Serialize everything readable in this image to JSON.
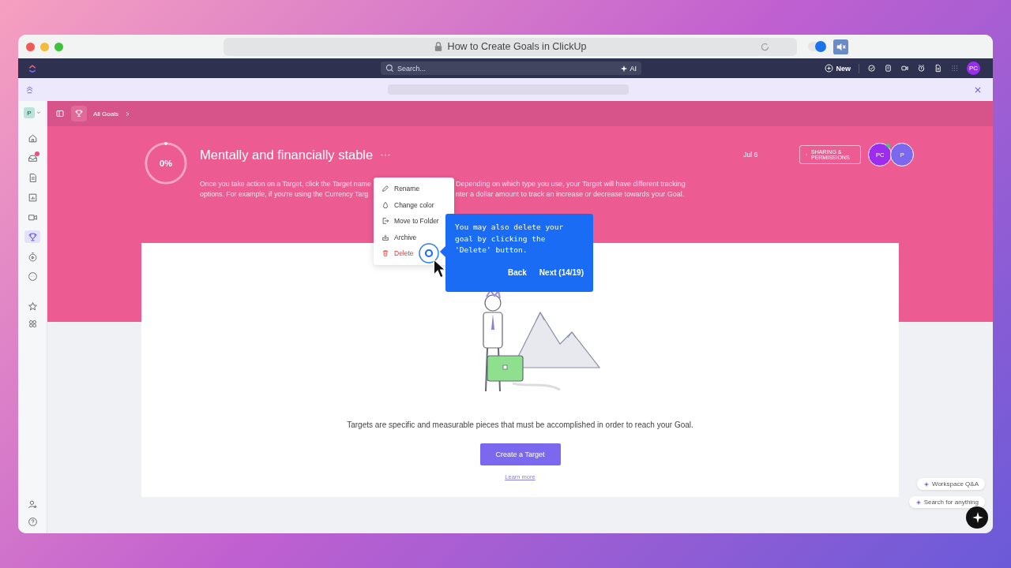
{
  "browser": {
    "title": "How to Create Goals in ClickUp",
    "autoplay_on": true
  },
  "topbar": {
    "search": {
      "placeholder": "Search..."
    },
    "ai_label": "AI",
    "new_label": "New",
    "avatar": "PC"
  },
  "workspace": {
    "initial": "P"
  },
  "sidebar": {
    "items": [
      {
        "selected": false
      },
      {
        "selected": false,
        "badge": true
      },
      {
        "selected": false
      },
      {
        "selected": false
      },
      {
        "selected": false
      },
      {
        "selected": true
      },
      {
        "selected": false
      },
      {
        "selected": false
      }
    ]
  },
  "breadcrumb": {
    "label": "All Goals"
  },
  "goal": {
    "progress": {
      "label": "0%",
      "level": 0
    },
    "title": "Mentally and financially stable",
    "date": "Jul 6",
    "sharing": "SHARING & PERMISSIONS",
    "description": [
      [
        "Once you take action on a Target, click the Target name",
        "Depending on which type you use, your Target will have different tracking"
      ],
      [
        "options. For example, if you're using the Currency Targ",
        "nter a dollar amount to track an increase or decrease towards your Goal."
      ]
    ],
    "members": [
      {
        "initials": "PC",
        "color": "#9b2cf0",
        "online": true
      },
      {
        "initials": "P",
        "color": "#7b68ee",
        "online": false
      }
    ]
  },
  "menu": {
    "items": [
      {
        "label": "Rename",
        "kind": "rename"
      },
      {
        "label": "Change color",
        "kind": "color"
      },
      {
        "label": "Move to Folder",
        "kind": "move"
      },
      {
        "label": "Archive",
        "kind": "archive"
      },
      {
        "label": "Delete",
        "kind": "delete"
      }
    ]
  },
  "tour": {
    "text": "You may also delete your goal by clicking the 'Delete' button.",
    "back": "Back",
    "next": "Next (14/19)"
  },
  "empty": {
    "message": "Targets are specific and measurable pieces that must be accomplished in order to reach your Goal.",
    "button": "Create a Target",
    "link": "Learn more"
  },
  "assist": [
    "Workspace Q&A",
    "Search for anything"
  ]
}
